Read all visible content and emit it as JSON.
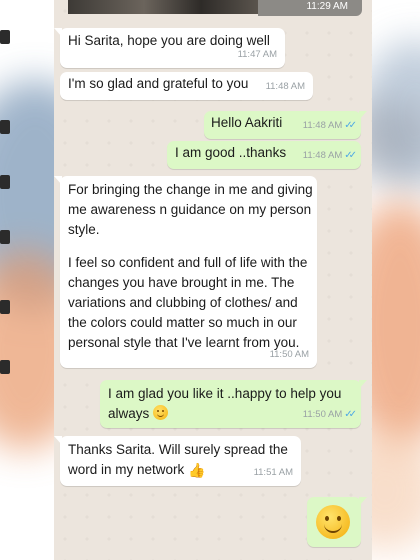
{
  "header": {
    "timestamp": "11:29 AM"
  },
  "messages": [
    {
      "dir": "in",
      "text": "Hi Sarita, hope you are doing well",
      "time": "11:47 AM"
    },
    {
      "dir": "in",
      "text": "I'm so glad and grateful to you",
      "time": "11:48 AM"
    },
    {
      "dir": "out",
      "text": "Hello Aakriti",
      "time": "11:48 AM"
    },
    {
      "dir": "out",
      "text": "I am good ..thanks",
      "time": "11:48 AM"
    },
    {
      "dir": "in",
      "text_lines": [
        "For bringing the change in me and giving",
        "me awareness n guidance on my person",
        "style.",
        "",
        "I feel so confident and full of life with the",
        "changes you have brought in me. The",
        "variations and clubbing of clothes/ and",
        "the colors could matter so much in our",
        "personal style that I've learnt from you."
      ],
      "time": "11:50 AM"
    },
    {
      "dir": "out",
      "text_lines": [
        "I am glad you like it ..happy to help you",
        "always"
      ],
      "emoji": "smiling-face",
      "time": "11:50 AM"
    },
    {
      "dir": "in",
      "text_lines": [
        "Thanks Sarita. Will surely spread the",
        "word in my network"
      ],
      "emoji": "thumbs-up",
      "time": "11:51 AM"
    },
    {
      "dir": "out",
      "emoji": "smiling-face"
    }
  ],
  "colors": {
    "incoming": "#ffffff",
    "outgoing": "#dcf8c6",
    "read_ticks": "#4fa9e5",
    "chat_bg": "#ece5dd"
  }
}
